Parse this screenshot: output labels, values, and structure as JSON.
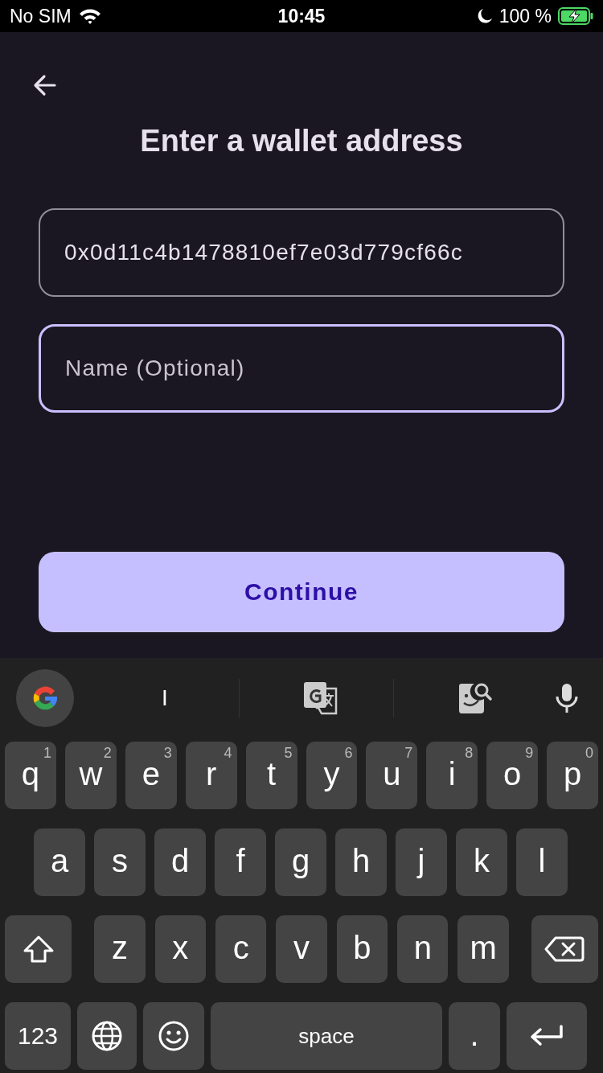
{
  "status_bar": {
    "carrier": "No SIM",
    "time": "10:45",
    "battery": "100 %"
  },
  "title": "Enter a wallet address",
  "address_field": {
    "value": "0x0d11c4b1478810ef7e03d779cf66c"
  },
  "name_field": {
    "placeholder": "Name (Optional)",
    "focused": true
  },
  "continue_button": {
    "label": "Continue"
  },
  "keyboard": {
    "suggestion": "I",
    "rows": [
      [
        {
          "kind": "letter",
          "label": "q",
          "hint": "1"
        },
        {
          "kind": "letter",
          "label": "w",
          "hint": "2"
        },
        {
          "kind": "letter",
          "label": "e",
          "hint": "3"
        },
        {
          "kind": "letter",
          "label": "r",
          "hint": "4"
        },
        {
          "kind": "letter",
          "label": "t",
          "hint": "5"
        },
        {
          "kind": "letter",
          "label": "y",
          "hint": "6"
        },
        {
          "kind": "letter",
          "label": "u",
          "hint": "7"
        },
        {
          "kind": "letter",
          "label": "i",
          "hint": "8"
        },
        {
          "kind": "letter",
          "label": "o",
          "hint": "9"
        },
        {
          "kind": "letter",
          "label": "p",
          "hint": "0"
        }
      ],
      [
        {
          "kind": "letter",
          "label": "a"
        },
        {
          "kind": "letter",
          "label": "s"
        },
        {
          "kind": "letter",
          "label": "d"
        },
        {
          "kind": "letter",
          "label": "f"
        },
        {
          "kind": "letter",
          "label": "g"
        },
        {
          "kind": "letter",
          "label": "h"
        },
        {
          "kind": "letter",
          "label": "j"
        },
        {
          "kind": "letter",
          "label": "k"
        },
        {
          "kind": "letter",
          "label": "l"
        }
      ],
      [
        {
          "kind": "shift"
        },
        {
          "kind": "letter",
          "label": "z"
        },
        {
          "kind": "letter",
          "label": "x"
        },
        {
          "kind": "letter",
          "label": "c"
        },
        {
          "kind": "letter",
          "label": "v"
        },
        {
          "kind": "letter",
          "label": "b"
        },
        {
          "kind": "letter",
          "label": "n"
        },
        {
          "kind": "letter",
          "label": "m"
        },
        {
          "kind": "backspace"
        }
      ],
      [
        {
          "kind": "symbols",
          "label": "123"
        },
        {
          "kind": "globe"
        },
        {
          "kind": "emoji"
        },
        {
          "kind": "space",
          "label": "space"
        },
        {
          "kind": "letter",
          "label": "."
        },
        {
          "kind": "enter"
        }
      ]
    ]
  }
}
